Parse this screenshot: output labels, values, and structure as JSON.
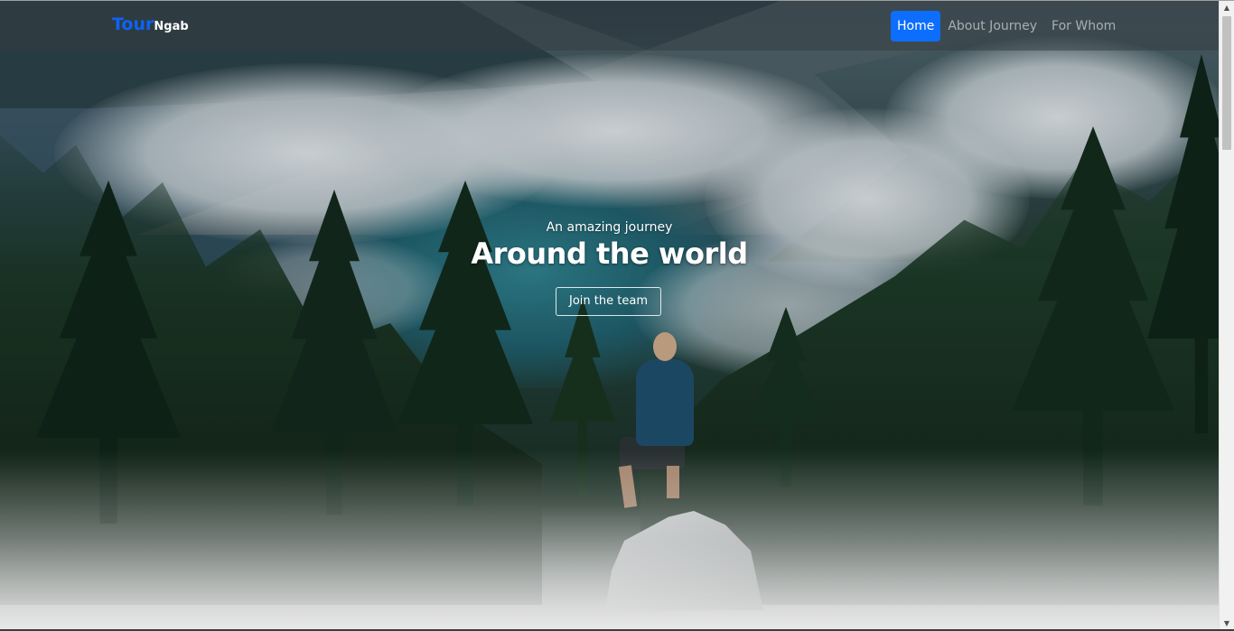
{
  "brand": {
    "part1": "Tour",
    "part2": "Ngab",
    "accent_color": "#0d63f5"
  },
  "nav": {
    "items": [
      {
        "label": "Home",
        "active": true
      },
      {
        "label": "About Journey",
        "active": false
      },
      {
        "label": "For Whom",
        "active": false
      }
    ],
    "active_color": "#0d6efd"
  },
  "hero": {
    "subtitle": "An amazing journey",
    "title": "Around the world",
    "button_label": "Join the team",
    "background_icon": "mountain-lake-hiker-photo"
  },
  "scrollbar": {
    "up_icon": "triangle-up-icon",
    "down_icon": "triangle-down-icon"
  }
}
